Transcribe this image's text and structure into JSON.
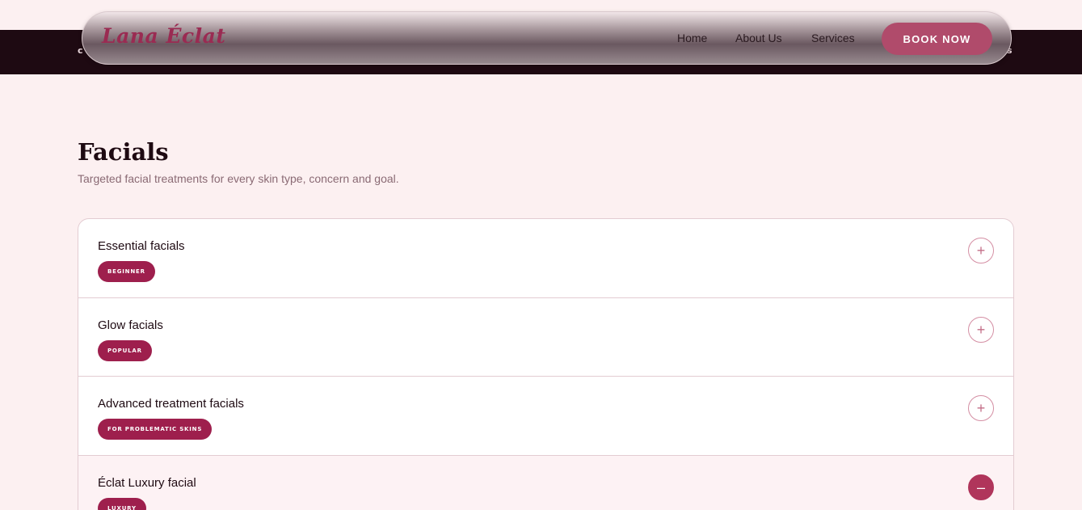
{
  "topband": {
    "left_fragment": "c",
    "right_fragment": "s"
  },
  "nav": {
    "brand": "Lana Éclat",
    "links": [
      "Home",
      "About Us",
      "Services"
    ],
    "cta": "BOOK NOW"
  },
  "section": {
    "title": "Facials",
    "subtitle": "Targeted facial treatments for every skin type, concern and goal."
  },
  "accordion": [
    {
      "title": "Essential facials",
      "badge": "BEGINNER",
      "toggle": "+"
    },
    {
      "title": "Glow facials",
      "badge": "POPULAR",
      "toggle": "+"
    },
    {
      "title": "Advanced treatment facials",
      "badge": "FOR PROBLEMATIC SKINS",
      "toggle": "+"
    },
    {
      "title": "Éclat Luxury facial",
      "badge": "LUXURY",
      "toggle": "–"
    }
  ],
  "colors": {
    "accent": "#9e1f4d",
    "cta": "#b04b6b",
    "background": "#fcf0f1",
    "dark_band": "#1e0a12"
  },
  "icons": {
    "expand": "plus-icon",
    "collapse": "minus-icon"
  }
}
